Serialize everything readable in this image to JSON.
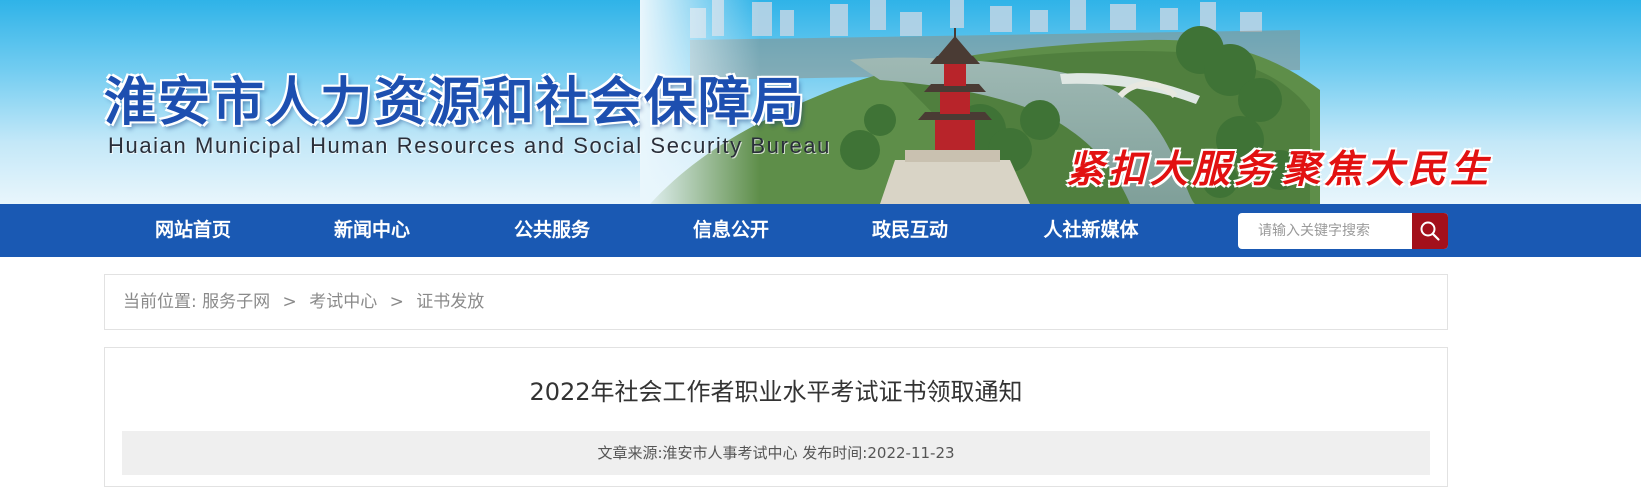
{
  "header": {
    "title": "淮安市人力资源和社会保障局",
    "subtitle": "Huaian Municipal Human Resources and Social Security Bureau",
    "slogan_left": "紧扣大服务",
    "slogan_right": "聚焦大民生"
  },
  "nav": {
    "items": [
      {
        "label": "网站首页"
      },
      {
        "label": "新闻中心"
      },
      {
        "label": "公共服务"
      },
      {
        "label": "信息公开"
      },
      {
        "label": "政民互动"
      },
      {
        "label": "人社新媒体"
      }
    ],
    "search_placeholder": "请输入关键字搜索",
    "search_icon": "search-icon"
  },
  "breadcrumb": {
    "prefix": "当前位置:",
    "items": [
      "服务子网",
      "考试中心",
      "证书发放"
    ],
    "separator": ">"
  },
  "article": {
    "title": "2022年社会工作者职业水平考试证书领取通知",
    "source_label": "文章来源:",
    "source_value": "淮安市人事考试中心",
    "date_label": "发布时间:",
    "date_value": "2022-11-23"
  },
  "colors": {
    "nav_bg": "#1a59b3",
    "search_button": "#a3101b",
    "title_blue": "#1d4fb0",
    "slogan_red": "#e21111"
  }
}
